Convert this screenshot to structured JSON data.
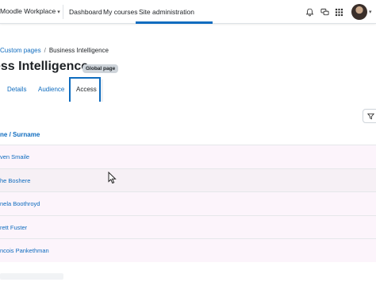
{
  "navbar": {
    "brand": "Moodle Workplace",
    "links": [
      "Dashboard",
      "My courses",
      "Site administration"
    ],
    "active_link": "Site administration",
    "icons": [
      "bell-icon",
      "chat-icon",
      "app-grid-icon"
    ]
  },
  "breadcrumb": {
    "items": [
      "Custom pages",
      "Business Intelligence"
    ]
  },
  "page": {
    "title": "ess Intelligence",
    "badge": "Global page"
  },
  "tabs": {
    "items": [
      "Details",
      "Audience",
      "Access"
    ],
    "active": "Access"
  },
  "table": {
    "column_header_a": "ne",
    "column_header_b": "Surname",
    "rows": [
      "ven Smaile",
      "he Boshere",
      "nela Boothroyd",
      "rett Fuster",
      "ncois Pankethman"
    ]
  },
  "colors": {
    "accent": "#0f6cbf",
    "row_bg": "#fcf4fb"
  }
}
